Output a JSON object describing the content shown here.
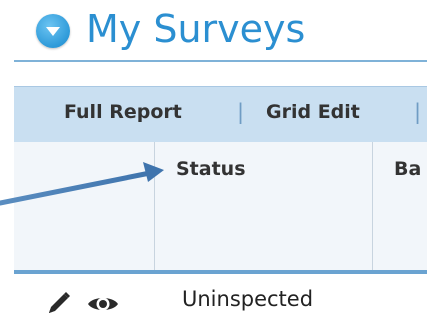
{
  "header": {
    "title": "My Surveys",
    "toggle_icon": "chevron-down-icon"
  },
  "toolbar": {
    "full_report_label": "Full Report",
    "grid_edit_label": "Grid Edit",
    "separator": "|"
  },
  "table": {
    "columns": [
      "Status",
      "Ba"
    ],
    "rows": [
      {
        "edit_icon": "pencil-icon",
        "view_icon": "eye-icon",
        "status": "Uninspected"
      }
    ]
  },
  "annotation": {
    "icon": "arrow-icon",
    "color": "#4a7fb5"
  },
  "colors": {
    "accent": "#2b8fd1",
    "toolbar_bg": "#c9dff1",
    "header_row_bg": "#f2f6fa",
    "rule": "#6aa3d1"
  }
}
